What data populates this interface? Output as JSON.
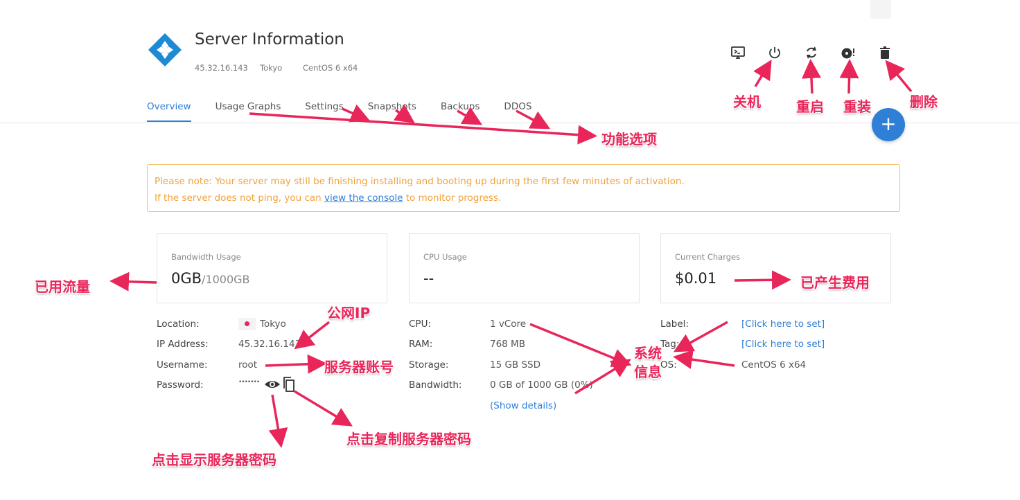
{
  "header": {
    "title": "Server Information",
    "ip": "45.32.16.143",
    "location": "Tokyo",
    "os": "CentOS 6 x64"
  },
  "tabs": [
    "Overview",
    "Usage Graphs",
    "Settings",
    "Snapshots",
    "Backups",
    "DDOS"
  ],
  "toolbar": {
    "console_icon": "monitor-icon",
    "power_icon": "power-icon",
    "restart_icon": "refresh-icon",
    "reinstall_icon": "disc-icon",
    "delete_icon": "trash-icon",
    "add_label": "+"
  },
  "notice": {
    "line1": "Please note: Your server may still be finishing installing and booting up during the first few minutes of activation.",
    "line2_pre": "If the server does not ping, you can ",
    "line2_link": "view the console",
    "line2_post": " to monitor progress."
  },
  "cards": {
    "bandwidth": {
      "label": "Bandwidth Usage",
      "value": "0GB",
      "limit": "/1000GB"
    },
    "cpu": {
      "label": "CPU Usage",
      "value": "--"
    },
    "charges": {
      "label": "Current Charges",
      "value": "$0.01"
    }
  },
  "info_left": {
    "location_key": "Location:",
    "location_val": "Tokyo",
    "ip_key": "IP Address:",
    "ip_val": "45.32.16.143",
    "user_key": "Username:",
    "user_val": "root",
    "pass_key": "Password:",
    "pass_val": "•••••••"
  },
  "info_mid": {
    "cpu_key": "CPU:",
    "cpu_val": "1 vCore",
    "ram_key": "RAM:",
    "ram_val": "768 MB",
    "storage_key": "Storage:",
    "storage_val": "15 GB SSD",
    "bw_key": "Bandwidth:",
    "bw_val": "0 GB of 1000 GB (0%)",
    "details_link": "(Show details)"
  },
  "info_right": {
    "label_key": "Label:",
    "label_val": "[Click here to set]",
    "tag_key": "Tag:",
    "tag_val": "[Click here to set]",
    "os_key": "OS:",
    "os_val": "CentOS 6 x64"
  },
  "annotations": {
    "shutdown": "关机",
    "restart": "重启",
    "reinstall": "重装",
    "delete": "删除",
    "features": "功能选项",
    "bandwidth_used": "已用流量",
    "charges": "已产生费用",
    "public_ip": "公网IP",
    "account": "服务器账号",
    "system_info_1": "系统",
    "system_info_2": "信息",
    "show_password": "点击显示服务器密码",
    "copy_password": "点击复制服务器密码"
  },
  "colors": {
    "accent": "#2f7fd6",
    "annotation": "#e8265a",
    "notice": "#f0a23a"
  }
}
